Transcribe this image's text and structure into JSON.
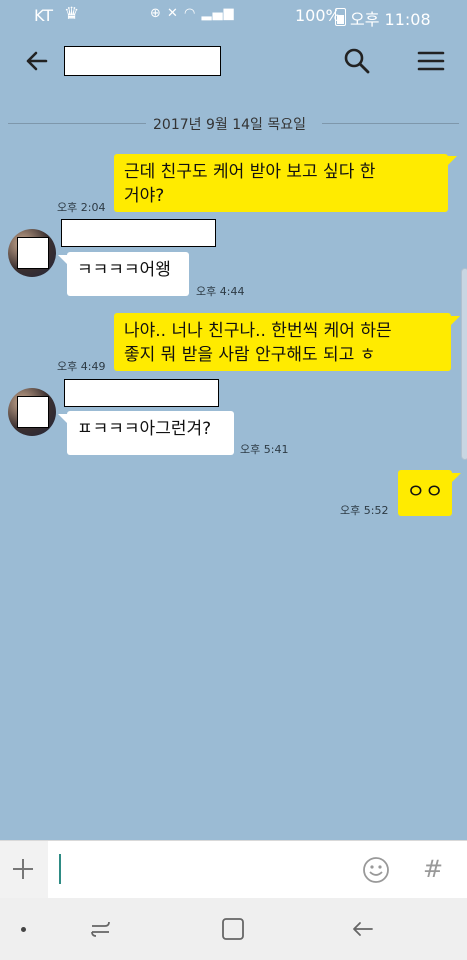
{
  "status_bar": {
    "carrier": "KT",
    "battery": "100%",
    "time": "오후 11:08"
  },
  "date_divider": "2017년 9월 14일 목요일",
  "messages": [
    {
      "sender": "me",
      "lines": [
        "근데 친구도 케어 받아 보고 싶다 한",
        "거야?"
      ],
      "time": "오후 2:04"
    },
    {
      "sender": "other",
      "lines": [
        "ㅋㅋㅋㅋ어왱"
      ],
      "time": "오후 4:44"
    },
    {
      "sender": "me",
      "lines": [
        "나야.. 너나 친구나.. 한번씩 케어 하믄",
        "좋지 뭐 받을 사람 안구해도 되고 ㅎ"
      ],
      "time": "오후 4:49"
    },
    {
      "sender": "other",
      "lines": [
        "ㅍㅋㅋㅋ아그런겨?"
      ],
      "time": "오후 5:41"
    },
    {
      "sender": "me",
      "lines": [
        "ㅇㅇ"
      ],
      "time": "오후 5:52"
    }
  ],
  "icons": {
    "back": "arrow-left-icon",
    "search": "search-icon",
    "menu": "hamburger-menu-icon",
    "plus": "plus-icon",
    "emoji": "emoticon-icon",
    "hash": "hash-icon"
  },
  "input": {
    "hash_symbol": "#"
  },
  "colors": {
    "background": "#9bbbd4",
    "my_bubble": "#ffeb00",
    "other_bubble": "#ffffff",
    "caret": "#2e8b84"
  }
}
